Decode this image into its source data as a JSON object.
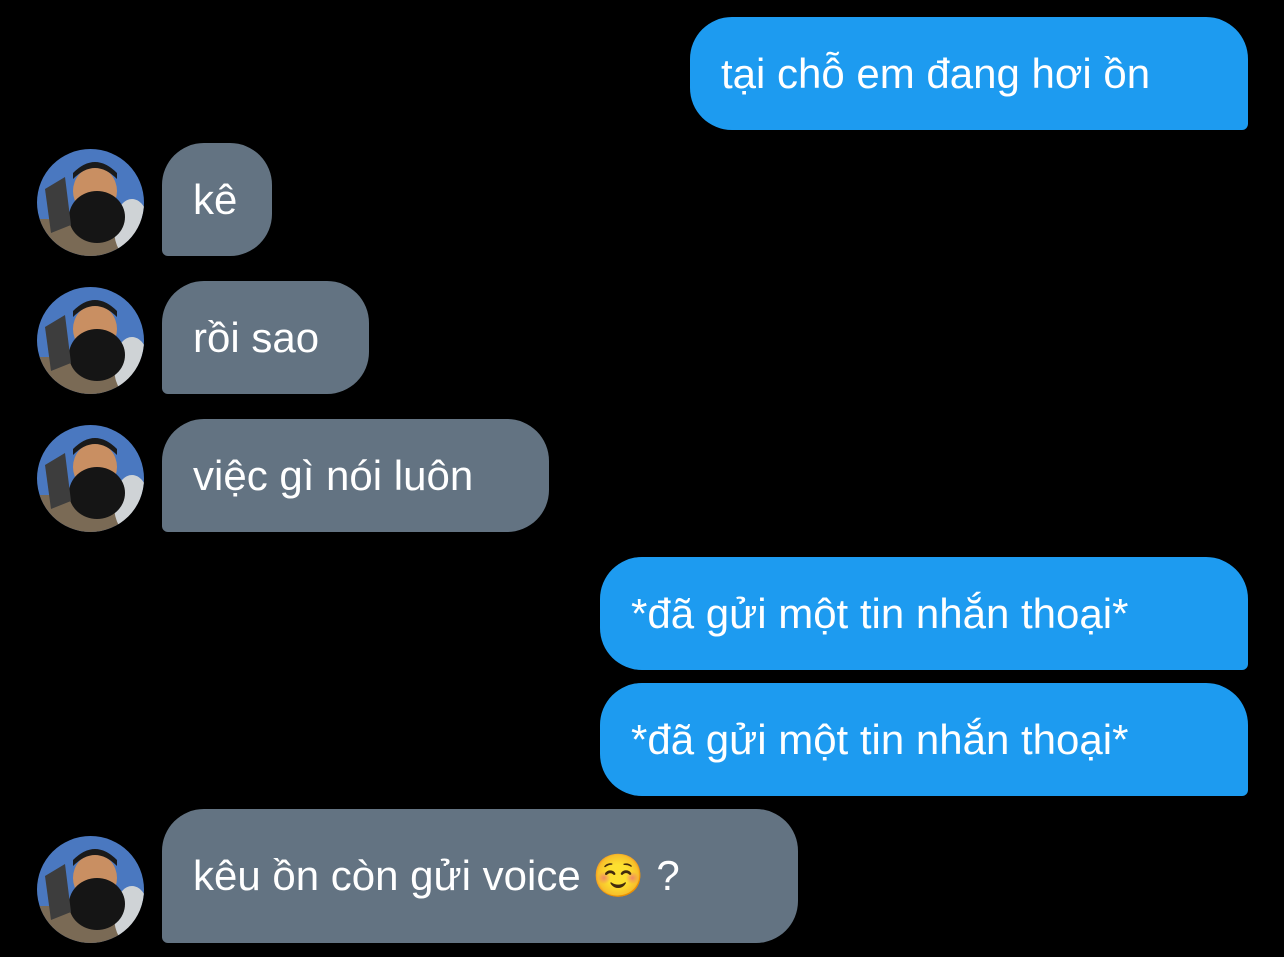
{
  "conversation": {
    "messages": [
      {
        "direction": "sent",
        "text": "tại chỗ em đang hơi ồn"
      },
      {
        "direction": "received",
        "text": "kê",
        "avatar_icon": "user-avatar-photo"
      },
      {
        "direction": "received",
        "text": "rồi sao",
        "avatar_icon": "user-avatar-photo"
      },
      {
        "direction": "received",
        "text": "việc gì nói luôn",
        "avatar_icon": "user-avatar-photo"
      },
      {
        "direction": "sent",
        "text": "*đã gửi một tin nhắn thoại*"
      },
      {
        "direction": "sent",
        "text": "*đã gửi một tin nhắn thoại*"
      },
      {
        "direction": "received",
        "text": "kêu ồn còn gửi voice ☺️ ?",
        "avatar_icon": "user-avatar-photo"
      }
    ]
  },
  "colors": {
    "background": "#000000",
    "sent_bubble": "#1d9bf0",
    "received_bubble": "#637382",
    "text": "#ffffff"
  }
}
